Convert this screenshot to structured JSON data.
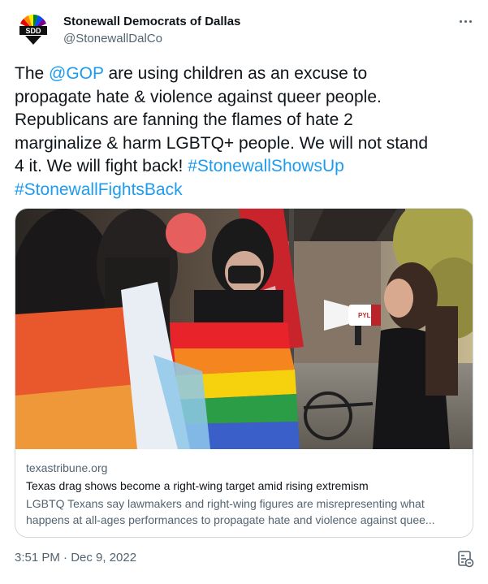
{
  "author": {
    "display_name": "Stonewall Democrats of Dallas",
    "handle": "@StonewallDalCo",
    "avatar_text": "SDD"
  },
  "tweet": {
    "lines": [
      [
        {
          "t": "The "
        },
        {
          "t": "@GOP",
          "link": true
        },
        {
          "t": " are using children as an excuse to"
        }
      ],
      [
        {
          "t": "propagate hate & violence against queer people."
        }
      ],
      [
        {
          "t": "Republicans are fanning the flames of hate 2"
        }
      ],
      [
        {
          "t": "marginalize & harm LGBTQ+ people.  We will not stand"
        }
      ],
      [
        {
          "t": "4 it.  We will fight back! "
        },
        {
          "t": "#StonewallShowsUp",
          "link": true
        }
      ],
      [
        {
          "t": "#StonewallFightsBack",
          "link": true
        }
      ]
    ]
  },
  "card": {
    "image_sign_text": "PYLE",
    "domain": "texastribune.org",
    "title": "Texas drag shows become a right-wing target amid rising extremism",
    "description_line1": "LGBTQ Texans say lawmakers and right-wing figures are misrepresenting what",
    "description_line2": "happens at all-ages performances to propagate hate and violence against quee..."
  },
  "timestamp": "3:51 PM · Dec 9, 2022",
  "icons": {
    "more": "more-options-icon",
    "analytics": "analytics-icon"
  },
  "colors": {
    "link": "#1d9bf0",
    "text": "#0f1419",
    "secondary": "#536471",
    "border": "#cfd9de"
  }
}
